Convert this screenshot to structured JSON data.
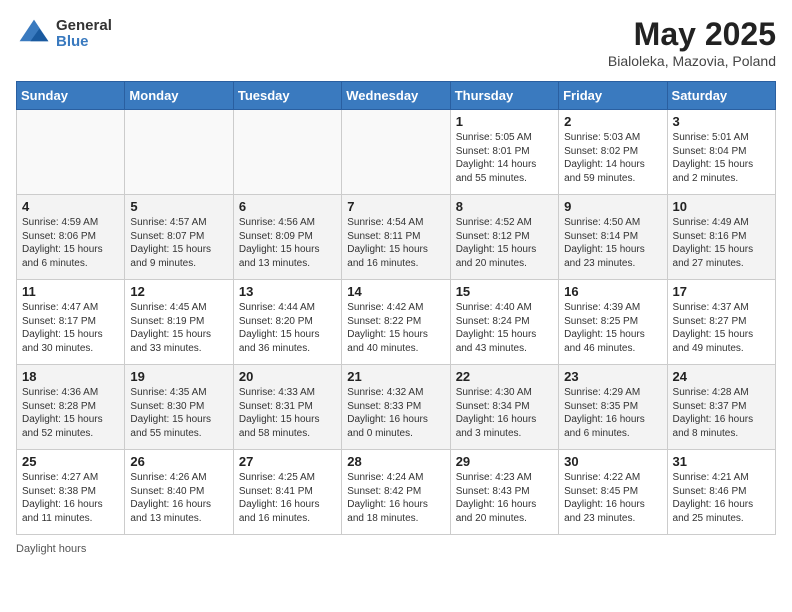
{
  "header": {
    "logo_general": "General",
    "logo_blue": "Blue",
    "month_year": "May 2025",
    "location": "Bialoleka, Mazovia, Poland"
  },
  "days_of_week": [
    "Sunday",
    "Monday",
    "Tuesday",
    "Wednesday",
    "Thursday",
    "Friday",
    "Saturday"
  ],
  "weeks": [
    [
      {
        "day": "",
        "text": ""
      },
      {
        "day": "",
        "text": ""
      },
      {
        "day": "",
        "text": ""
      },
      {
        "day": "",
        "text": ""
      },
      {
        "day": "1",
        "text": "Sunrise: 5:05 AM\nSunset: 8:01 PM\nDaylight: 14 hours\nand 55 minutes."
      },
      {
        "day": "2",
        "text": "Sunrise: 5:03 AM\nSunset: 8:02 PM\nDaylight: 14 hours\nand 59 minutes."
      },
      {
        "day": "3",
        "text": "Sunrise: 5:01 AM\nSunset: 8:04 PM\nDaylight: 15 hours\nand 2 minutes."
      }
    ],
    [
      {
        "day": "4",
        "text": "Sunrise: 4:59 AM\nSunset: 8:06 PM\nDaylight: 15 hours\nand 6 minutes."
      },
      {
        "day": "5",
        "text": "Sunrise: 4:57 AM\nSunset: 8:07 PM\nDaylight: 15 hours\nand 9 minutes."
      },
      {
        "day": "6",
        "text": "Sunrise: 4:56 AM\nSunset: 8:09 PM\nDaylight: 15 hours\nand 13 minutes."
      },
      {
        "day": "7",
        "text": "Sunrise: 4:54 AM\nSunset: 8:11 PM\nDaylight: 15 hours\nand 16 minutes."
      },
      {
        "day": "8",
        "text": "Sunrise: 4:52 AM\nSunset: 8:12 PM\nDaylight: 15 hours\nand 20 minutes."
      },
      {
        "day": "9",
        "text": "Sunrise: 4:50 AM\nSunset: 8:14 PM\nDaylight: 15 hours\nand 23 minutes."
      },
      {
        "day": "10",
        "text": "Sunrise: 4:49 AM\nSunset: 8:16 PM\nDaylight: 15 hours\nand 27 minutes."
      }
    ],
    [
      {
        "day": "11",
        "text": "Sunrise: 4:47 AM\nSunset: 8:17 PM\nDaylight: 15 hours\nand 30 minutes."
      },
      {
        "day": "12",
        "text": "Sunrise: 4:45 AM\nSunset: 8:19 PM\nDaylight: 15 hours\nand 33 minutes."
      },
      {
        "day": "13",
        "text": "Sunrise: 4:44 AM\nSunset: 8:20 PM\nDaylight: 15 hours\nand 36 minutes."
      },
      {
        "day": "14",
        "text": "Sunrise: 4:42 AM\nSunset: 8:22 PM\nDaylight: 15 hours\nand 40 minutes."
      },
      {
        "day": "15",
        "text": "Sunrise: 4:40 AM\nSunset: 8:24 PM\nDaylight: 15 hours\nand 43 minutes."
      },
      {
        "day": "16",
        "text": "Sunrise: 4:39 AM\nSunset: 8:25 PM\nDaylight: 15 hours\nand 46 minutes."
      },
      {
        "day": "17",
        "text": "Sunrise: 4:37 AM\nSunset: 8:27 PM\nDaylight: 15 hours\nand 49 minutes."
      }
    ],
    [
      {
        "day": "18",
        "text": "Sunrise: 4:36 AM\nSunset: 8:28 PM\nDaylight: 15 hours\nand 52 minutes."
      },
      {
        "day": "19",
        "text": "Sunrise: 4:35 AM\nSunset: 8:30 PM\nDaylight: 15 hours\nand 55 minutes."
      },
      {
        "day": "20",
        "text": "Sunrise: 4:33 AM\nSunset: 8:31 PM\nDaylight: 15 hours\nand 58 minutes."
      },
      {
        "day": "21",
        "text": "Sunrise: 4:32 AM\nSunset: 8:33 PM\nDaylight: 16 hours\nand 0 minutes."
      },
      {
        "day": "22",
        "text": "Sunrise: 4:30 AM\nSunset: 8:34 PM\nDaylight: 16 hours\nand 3 minutes."
      },
      {
        "day": "23",
        "text": "Sunrise: 4:29 AM\nSunset: 8:35 PM\nDaylight: 16 hours\nand 6 minutes."
      },
      {
        "day": "24",
        "text": "Sunrise: 4:28 AM\nSunset: 8:37 PM\nDaylight: 16 hours\nand 8 minutes."
      }
    ],
    [
      {
        "day": "25",
        "text": "Sunrise: 4:27 AM\nSunset: 8:38 PM\nDaylight: 16 hours\nand 11 minutes."
      },
      {
        "day": "26",
        "text": "Sunrise: 4:26 AM\nSunset: 8:40 PM\nDaylight: 16 hours\nand 13 minutes."
      },
      {
        "day": "27",
        "text": "Sunrise: 4:25 AM\nSunset: 8:41 PM\nDaylight: 16 hours\nand 16 minutes."
      },
      {
        "day": "28",
        "text": "Sunrise: 4:24 AM\nSunset: 8:42 PM\nDaylight: 16 hours\nand 18 minutes."
      },
      {
        "day": "29",
        "text": "Sunrise: 4:23 AM\nSunset: 8:43 PM\nDaylight: 16 hours\nand 20 minutes."
      },
      {
        "day": "30",
        "text": "Sunrise: 4:22 AM\nSunset: 8:45 PM\nDaylight: 16 hours\nand 23 minutes."
      },
      {
        "day": "31",
        "text": "Sunrise: 4:21 AM\nSunset: 8:46 PM\nDaylight: 16 hours\nand 25 minutes."
      }
    ]
  ],
  "footer": {
    "daylight_hours": "Daylight hours"
  }
}
